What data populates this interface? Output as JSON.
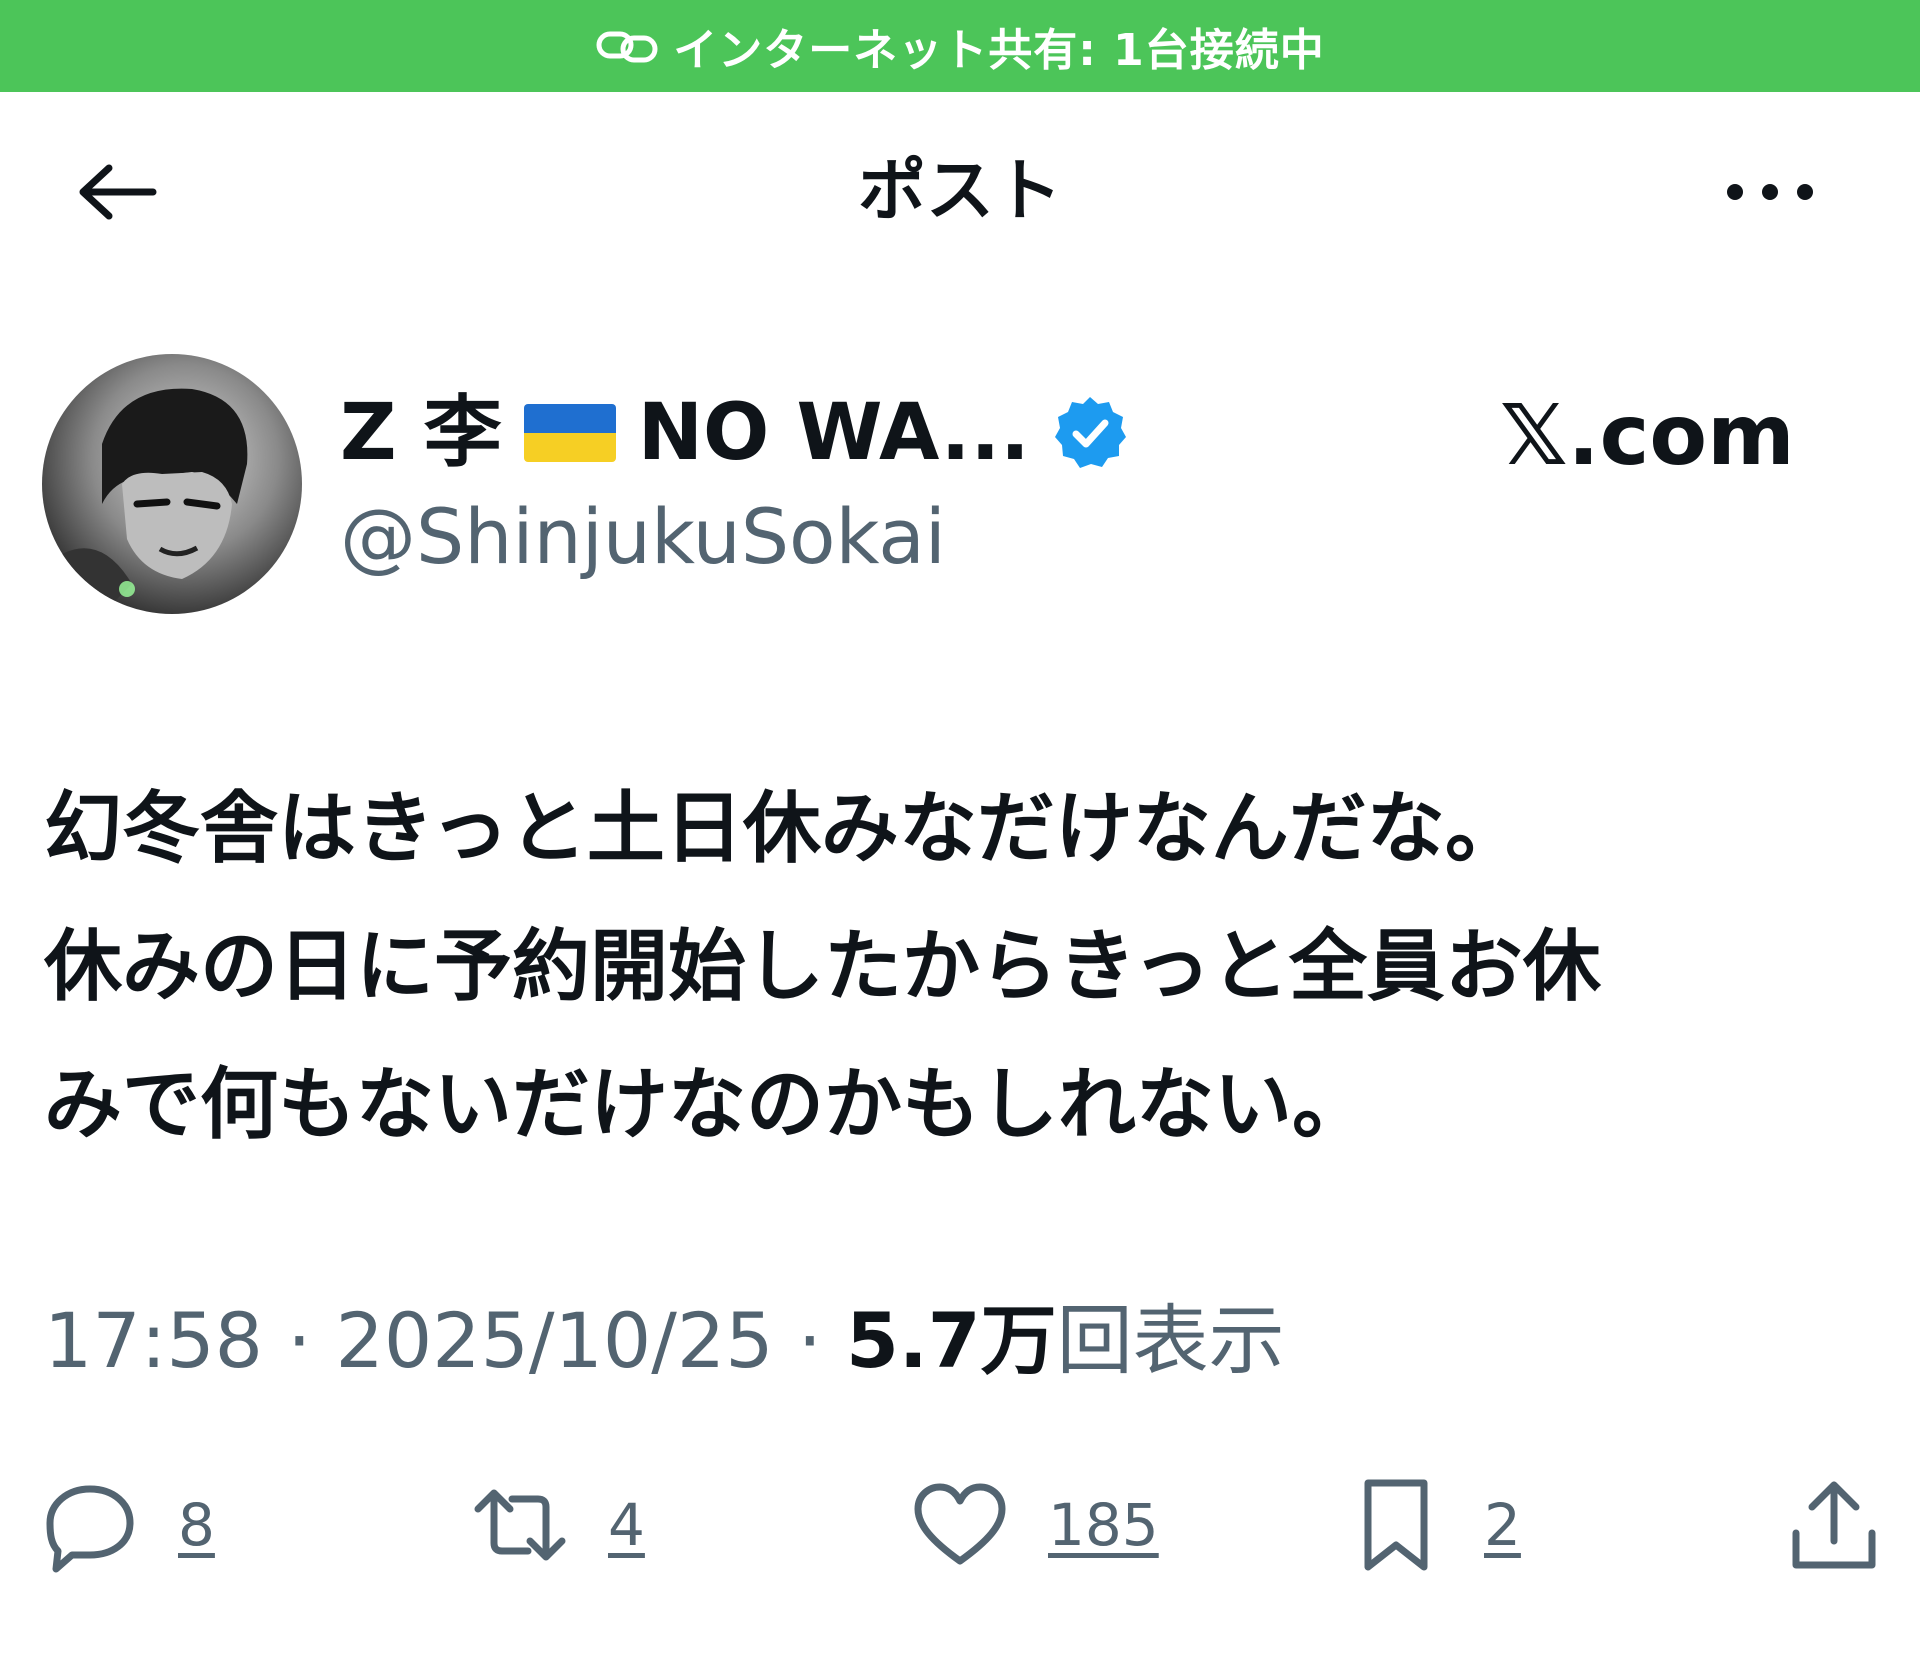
{
  "status_bar": {
    "hotspot_text": "インターネット共有: 1台接続中",
    "background_color": "#4cc559",
    "icon": "link-icon"
  },
  "nav": {
    "back_icon": "arrow-left-icon",
    "title": "ポスト",
    "more_icon": "more-horizontal-icon"
  },
  "author": {
    "name_part1": "Z 李",
    "flag": "ukraine-flag",
    "name_part2": "NO WA...",
    "verified": "verified-badge-icon",
    "handle": "@ShinjukuSokai",
    "watermark": "𝕏.com"
  },
  "tweet": {
    "lines": [
      "幻冬舎はきっと土日休みなだけなんだな。",
      "休みの日に予約開始したからきっと全員お休",
      "みで何もないだけなのかもしれない。"
    ]
  },
  "meta": {
    "time": "17:58",
    "separator1": " · ",
    "date": "2025/10/25",
    "separator2": " · ",
    "views_count": "5.7万",
    "views_label": "回表示"
  },
  "actions": {
    "reply": {
      "icon": "reply-icon",
      "count": "8"
    },
    "repost": {
      "icon": "repost-icon",
      "count": "4"
    },
    "like": {
      "icon": "heart-icon",
      "count": "185"
    },
    "bookmark": {
      "icon": "bookmark-icon",
      "count": "2"
    },
    "share": {
      "icon": "share-icon"
    }
  },
  "colors": {
    "text_primary": "#0f1419",
    "text_secondary": "#536471",
    "verified_blue": "#1d9bf0"
  }
}
